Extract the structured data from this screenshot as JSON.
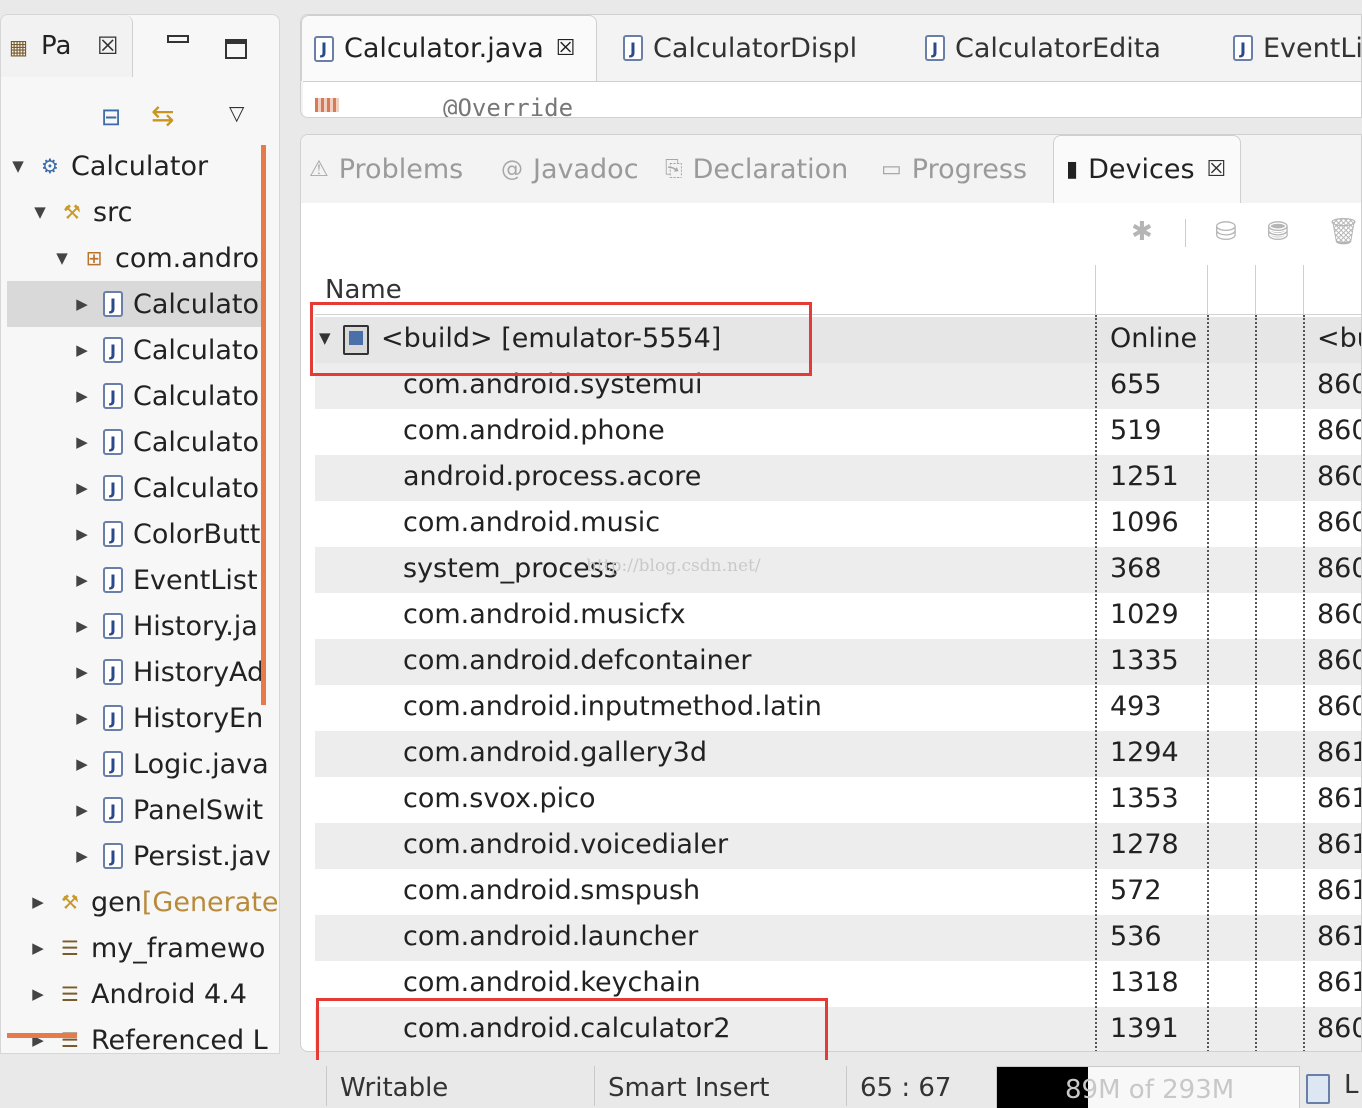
{
  "package_explorer": {
    "tab_label": "Pa",
    "items": [
      {
        "arrow": "▼",
        "icon": "project-icon",
        "label": "Calculator",
        "suffix": ""
      },
      {
        "arrow": "▼",
        "icon": "source-folder-icon",
        "label": "src",
        "suffix": ""
      },
      {
        "arrow": "▼",
        "icon": "package-icon",
        "label": "com.andro",
        "suffix": ""
      },
      {
        "arrow": "▶",
        "icon": "java-file-icon",
        "label": "Calculato",
        "suffix": ""
      },
      {
        "arrow": "▶",
        "icon": "java-file-icon",
        "label": "Calculato",
        "suffix": ""
      },
      {
        "arrow": "▶",
        "icon": "java-file-icon",
        "label": "Calculato",
        "suffix": ""
      },
      {
        "arrow": "▶",
        "icon": "java-file-icon",
        "label": "Calculato",
        "suffix": ""
      },
      {
        "arrow": "▶",
        "icon": "java-file-icon",
        "label": "Calculato",
        "suffix": ""
      },
      {
        "arrow": "▶",
        "icon": "java-file-icon",
        "label": "ColorButt",
        "suffix": ""
      },
      {
        "arrow": "▶",
        "icon": "java-file-icon",
        "label": "EventList",
        "suffix": ""
      },
      {
        "arrow": "▶",
        "icon": "java-file-icon",
        "label": "History.ja",
        "suffix": ""
      },
      {
        "arrow": "▶",
        "icon": "java-file-icon",
        "label": "HistoryAd",
        "suffix": ""
      },
      {
        "arrow": "▶",
        "icon": "java-file-icon",
        "label": "HistoryEn",
        "suffix": ""
      },
      {
        "arrow": "▶",
        "icon": "java-file-icon",
        "label": "Logic.java",
        "suffix": ""
      },
      {
        "arrow": "▶",
        "icon": "java-file-icon",
        "label": "PanelSwit",
        "suffix": ""
      },
      {
        "arrow": "▶",
        "icon": "java-file-icon",
        "label": "Persist.jav",
        "suffix": ""
      },
      {
        "arrow": "▶",
        "icon": "generated-folder-icon",
        "label": "gen ",
        "suffix": "[Generate"
      },
      {
        "arrow": "▶",
        "icon": "library-icon",
        "label": "my_framewo",
        "suffix": ""
      },
      {
        "arrow": "▶",
        "icon": "library-icon",
        "label": "Android 4.4",
        "suffix": ""
      },
      {
        "arrow": "▶",
        "icon": "library-icon",
        "label": "Referenced L",
        "suffix": ""
      }
    ]
  },
  "editor": {
    "tabs": [
      {
        "label": "Calculator.java",
        "active": true
      },
      {
        "label": "CalculatorDispl",
        "active": false
      },
      {
        "label": "CalculatorEdita",
        "active": false
      },
      {
        "label": "EventLis",
        "active": false
      }
    ],
    "visible_code": "@Override"
  },
  "views": {
    "tabs": [
      {
        "label": "Problems",
        "icon": "problems-icon",
        "active": false
      },
      {
        "label": "Javadoc",
        "icon": "javadoc-icon",
        "active": false
      },
      {
        "label": "Declaration",
        "icon": "declaration-icon",
        "active": false
      },
      {
        "label": "Progress",
        "icon": "progress-icon",
        "active": false
      },
      {
        "label": "Devices",
        "icon": "device-phone-icon",
        "active": true
      }
    ]
  },
  "devices": {
    "column_header": "Name",
    "device": {
      "name": "<build> [emulator-5554]",
      "status": "Online",
      "extra": "<bu"
    },
    "processes": [
      {
        "name": "com.android.systemui",
        "pid": "655",
        "port": "860"
      },
      {
        "name": "com.android.phone",
        "pid": "519",
        "port": "860"
      },
      {
        "name": "android.process.acore",
        "pid": "1251",
        "port": "860"
      },
      {
        "name": "com.android.music",
        "pid": "1096",
        "port": "860"
      },
      {
        "name": "system_process",
        "pid": "368",
        "port": "860"
      },
      {
        "name": "com.android.musicfx",
        "pid": "1029",
        "port": "860"
      },
      {
        "name": "com.android.defcontainer",
        "pid": "1335",
        "port": "860"
      },
      {
        "name": "com.android.inputmethod.latin",
        "pid": "493",
        "port": "860"
      },
      {
        "name": "com.android.gallery3d",
        "pid": "1294",
        "port": "861"
      },
      {
        "name": "com.svox.pico",
        "pid": "1353",
        "port": "861"
      },
      {
        "name": "com.android.voicedialer",
        "pid": "1278",
        "port": "861"
      },
      {
        "name": "com.android.smspush",
        "pid": "572",
        "port": "861"
      },
      {
        "name": "com.android.launcher",
        "pid": "536",
        "port": "861"
      },
      {
        "name": "com.android.keychain",
        "pid": "1318",
        "port": "861"
      },
      {
        "name": "com.android.calculator2",
        "pid": "1391",
        "port": "860"
      }
    ],
    "watermark": "http://blog.csdn.net/"
  },
  "status_bar": {
    "writable": "Writable",
    "insert_mode": "Smart Insert",
    "cursor_position": "65 : 67",
    "heap": "89M of 293M",
    "heap_used_fraction": 0.3,
    "trailing": "L"
  }
}
